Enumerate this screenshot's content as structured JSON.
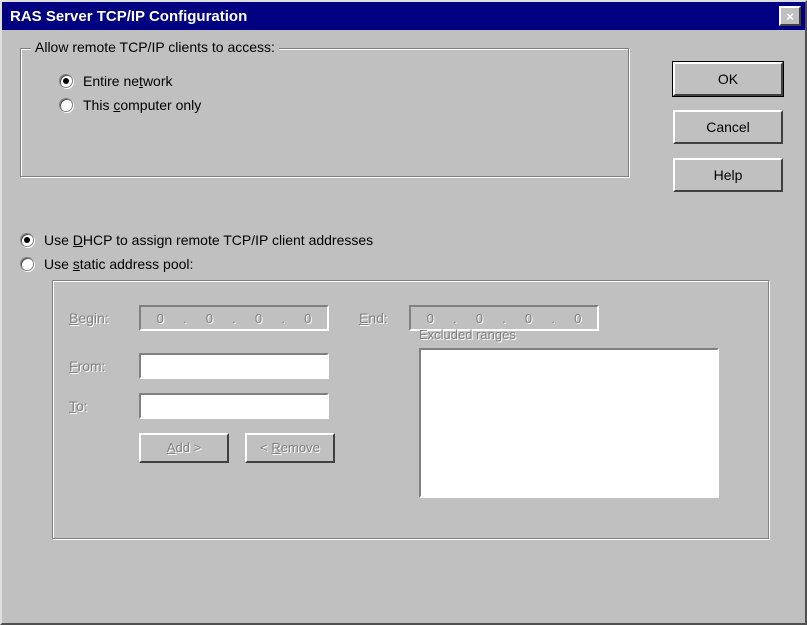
{
  "title": "RAS Server TCP/IP Configuration",
  "buttons": {
    "ok": "OK",
    "cancel": "Cancel",
    "help": "Help",
    "close_x": "×"
  },
  "access": {
    "legend": "Allow remote TCP/IP clients to access:",
    "entire_pre": "Entire ne",
    "entire_u": "t",
    "entire_post": "work",
    "thiscomp_pre": "This ",
    "thiscomp_u": "c",
    "thiscomp_post": "omputer only"
  },
  "assign": {
    "dhcp_pre": "Use ",
    "dhcp_u": "D",
    "dhcp_post": "HCP to assign remote TCP/IP client addresses",
    "static_pre": "Use ",
    "static_u": "s",
    "static_post": "tatic address pool:"
  },
  "pool": {
    "begin_pre": "",
    "begin_u": "B",
    "begin_post": "egin:",
    "end_pre": "",
    "end_u": "E",
    "end_post": "nd:",
    "from_pre": "",
    "from_u": "F",
    "from_post": "rom:",
    "to_pre": "",
    "to_u": "T",
    "to_post": "o:",
    "ip_zero": "0",
    "excluded": "Excluded ranges",
    "add_pre": "",
    "add_u": "A",
    "add_post": "dd >",
    "remove_pre": "< ",
    "remove_u": "R",
    "remove_post": "emove"
  }
}
